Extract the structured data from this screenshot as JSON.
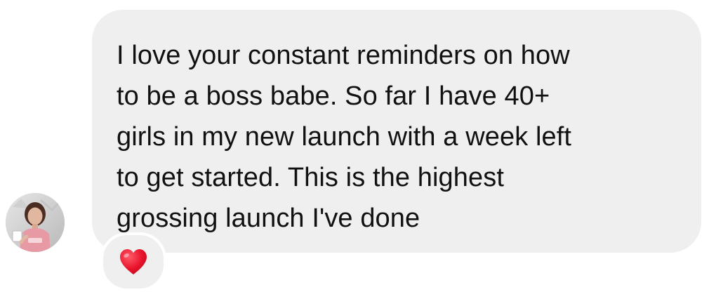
{
  "message": {
    "text": "I love your constant reminders on how\nto be a boss babe. So far I have 40+\ngirls in my new launch with a week left\nto get started. This is the highest\ngrossing launch I've done",
    "bubble_color": "#efefef",
    "text_color": "#111111"
  },
  "sender": {
    "avatar_icon": "profile-photo-icon"
  },
  "reaction": {
    "icon": "heart-icon",
    "color": "#e8132b"
  }
}
